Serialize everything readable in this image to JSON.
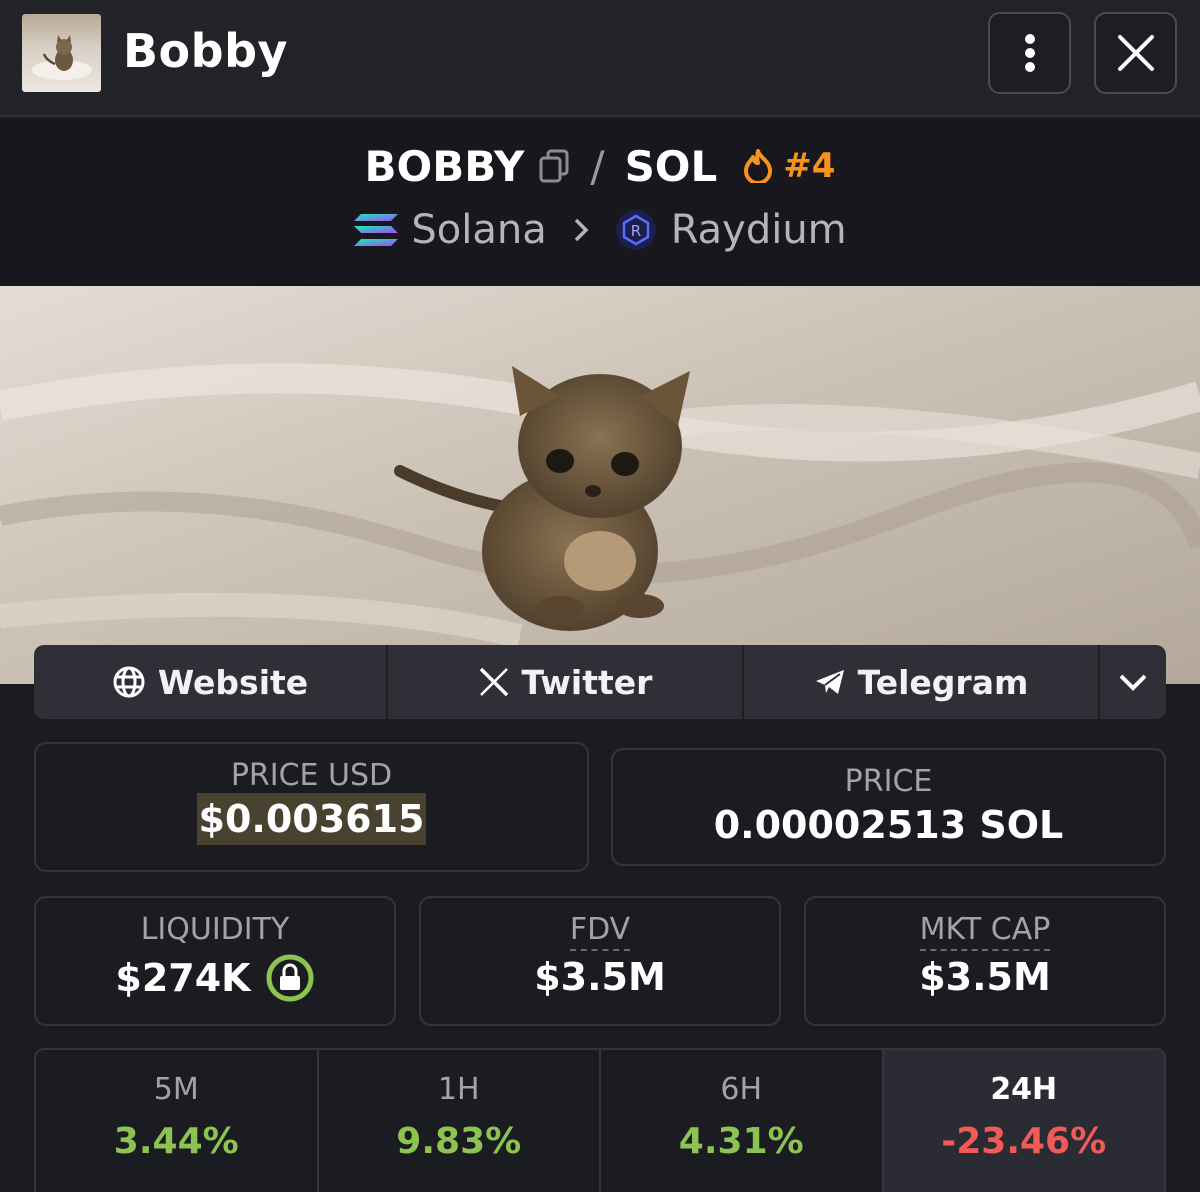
{
  "header": {
    "title": "Bobby"
  },
  "pair": {
    "base": "BOBBY",
    "separator": "/",
    "quote": "SOL",
    "rank": "#4",
    "chain": "Solana",
    "dex": "Raydium"
  },
  "links": [
    {
      "label": "Website",
      "icon": "globe-icon"
    },
    {
      "label": "Twitter",
      "icon": "x-icon"
    },
    {
      "label": "Telegram",
      "icon": "telegram-icon"
    }
  ],
  "price_usd": {
    "label": "PRICE USD",
    "value": "$0.003615"
  },
  "price_native": {
    "label": "PRICE",
    "value": "0.00002513 SOL"
  },
  "liquidity": {
    "label": "LIQUIDITY",
    "value": "$274K"
  },
  "fdv": {
    "label": "FDV",
    "value": "$3.5M"
  },
  "mkt_cap": {
    "label": "MKT CAP",
    "value": "$3.5M"
  },
  "changes": [
    {
      "label": "5M",
      "value": "3.44%"
    },
    {
      "label": "1H",
      "value": "9.83%"
    },
    {
      "label": "6H",
      "value": "4.31%"
    },
    {
      "label": "24H",
      "value": "-23.46%"
    }
  ],
  "colors": {
    "positive": "#8dc351",
    "negative": "#f05a57",
    "rank": "#f7931a",
    "lock": "#8dc351"
  }
}
